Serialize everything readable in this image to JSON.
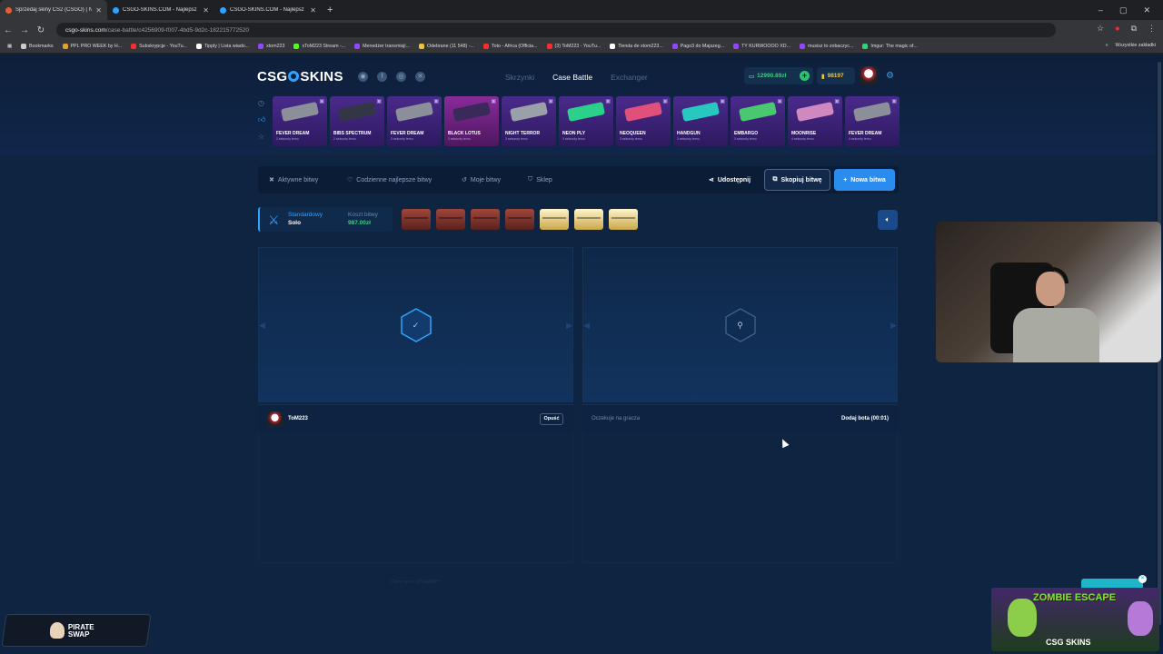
{
  "browser": {
    "tabs": [
      {
        "title": "Sprzedaj skiny CS2 (CSGO) | N",
        "active": true,
        "color": "#e06030"
      },
      {
        "title": "CSGO-SKINS.COM - Najlepsz",
        "active": false,
        "color": "#2fa3ff"
      },
      {
        "title": "CSGO-SKINS.COM - Najlepsz",
        "active": false,
        "color": "#2fa3ff"
      }
    ],
    "url_host": "csgo-skins.com",
    "url_path": "/case-battle/c4256909-f007-4bd5-9d2c-182215772520",
    "bookmarks": [
      {
        "label": "Bookmarks",
        "color": "#cccccc"
      },
      {
        "label": "PPL PRO WEEK by H...",
        "color": "#e0a030"
      },
      {
        "label": "Subskrypcje - YouTu...",
        "color": "#ff2a2a"
      },
      {
        "label": "Tipply | Lista wiado...",
        "color": "#ffffff"
      },
      {
        "label": "xtom223",
        "color": "#9146ff"
      },
      {
        "label": "xToM223 Stream -...",
        "color": "#53fc18"
      },
      {
        "label": "Menedżer transmisji...",
        "color": "#9146ff"
      },
      {
        "label": "Odebrane (11 548) -...",
        "color": "#f0c23a"
      },
      {
        "label": "Toto - Africa (Officia...",
        "color": "#ff2a2a"
      },
      {
        "label": "(3) ToM223 - YouTu...",
        "color": "#ff2a2a"
      },
      {
        "label": "Tienda de xtom223...",
        "color": "#ffffff"
      },
      {
        "label": "Pago3 do Majszeg...",
        "color": "#9146ff"
      },
      {
        "label": "TY KURWOOOO XD...",
        "color": "#9146ff"
      },
      {
        "label": "musisz to zobaczyc...",
        "color": "#9146ff"
      },
      {
        "label": "Imgur: The magic of...",
        "color": "#33d17a"
      }
    ],
    "all_bookmarks": "Wszystkie zakładki"
  },
  "site": {
    "logo": {
      "left": "CSG",
      "right": "SKINS"
    },
    "nav": [
      {
        "label": "Skrzynki",
        "active": false
      },
      {
        "label": "Case Battle",
        "active": true
      },
      {
        "label": "Exchanger",
        "active": false
      }
    ],
    "balance": "12990.89zł",
    "coins": "98197"
  },
  "drops": [
    {
      "name": "FEVER DREAM",
      "sub": "2 sekundy temu",
      "gun": "#8a8f99",
      "pink": false
    },
    {
      "name": "BIBS SPECTRUM",
      "sub": "2 sekundy temu",
      "gun": "#333644",
      "pink": false
    },
    {
      "name": "FEVER DREAM",
      "sub": "2 sekundy temu",
      "gun": "#8a8f99",
      "pink": false
    },
    {
      "name": "BLACK LOTUS",
      "sub": "3 sekundy temu",
      "gun": "#3a2a5a",
      "pink": true
    },
    {
      "name": "NIGHT TERROR",
      "sub": "3 sekundy temu",
      "gun": "#9aa0aa",
      "pink": false
    },
    {
      "name": "NEON PLY",
      "sub": "3 sekundy temu",
      "gun": "#2bd18a",
      "pink": false
    },
    {
      "name": "NEOQUEEN",
      "sub": "3 sekundy temu",
      "gun": "#e0507a",
      "pink": false
    },
    {
      "name": "HANDGUN",
      "sub": "3 sekundy temu",
      "gun": "#28c7c0",
      "pink": false
    },
    {
      "name": "EMBARGO",
      "sub": "3 sekundy temu",
      "gun": "#4ac870",
      "pink": false
    },
    {
      "name": "MOONRISE",
      "sub": "4 sekundy temu",
      "gun": "#d088c0",
      "pink": false
    },
    {
      "name": "FEVER DREAM",
      "sub": "4 sekundy temu",
      "gun": "#8a8f99",
      "pink": false
    }
  ],
  "toolbar": {
    "active": "Aktywne bitwy",
    "daily": "Codzienne najlepsze bitwy",
    "mine": "Moje bitwy",
    "shop": "Sklep",
    "share": "Udostępnij",
    "copy": "Skopiuj bitwę",
    "new": "Nowa bitwa"
  },
  "battle": {
    "mode_label": "Standardowy",
    "mode_value": "Solo",
    "cost_label": "Koszt bitwy",
    "cost_value": "987.00zł",
    "cases": [
      "red",
      "red",
      "red",
      "red",
      "gold",
      "gold",
      "gold"
    ]
  },
  "players": {
    "p1_name": "ToM223",
    "leave": "Opuść",
    "waiting": "Oczekuje na gracza",
    "add_bot": "Dodaj bota (00:01)"
  },
  "seed": "Client seed: UTDANMH",
  "overlays": {
    "pirate": "PIRATE\nSWAP",
    "zombie": "ZOMBIE ESCAPE",
    "brand": "CSG SKINS"
  }
}
